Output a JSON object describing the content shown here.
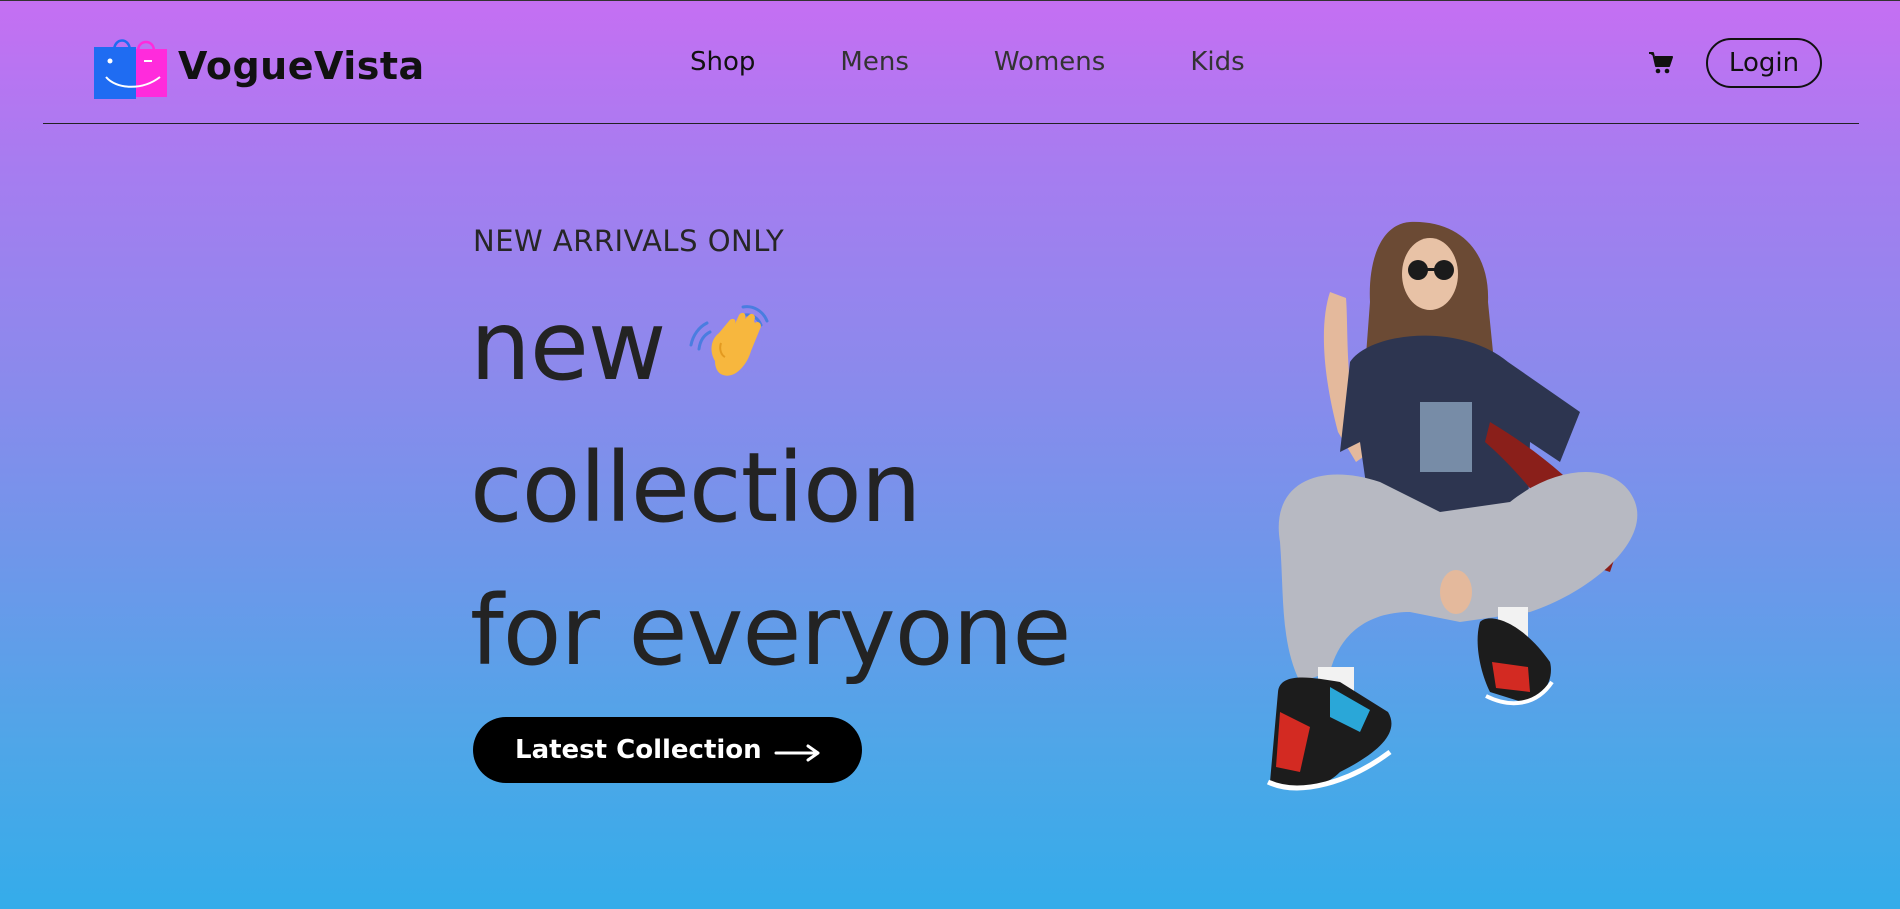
{
  "brand": {
    "name": "VogueVista",
    "logo_icon": "shopping-bags-logo-icon"
  },
  "nav": {
    "links": [
      {
        "label": "Shop",
        "active": true
      },
      {
        "label": "Mens",
        "active": false
      },
      {
        "label": "Womens",
        "active": false
      },
      {
        "label": "Kids",
        "active": false
      }
    ],
    "cart_icon": "cart-icon",
    "login_label": "Login"
  },
  "hero": {
    "eyebrow": "NEW ARRIVALS ONLY",
    "line1": "new",
    "line1_icon": "waving-hand-icon",
    "line2": "collection",
    "line3": "for everyone",
    "cta_label": "Latest Collection",
    "cta_icon": "arrow-right-icon",
    "image": "model-crouching-photo"
  },
  "colors": {
    "gradient_top": "#c56ff3",
    "gradient_bottom": "#34acea",
    "cta_bg": "#000000",
    "logo_blue": "#1f6cf2",
    "logo_pink": "#ff2bdc"
  }
}
